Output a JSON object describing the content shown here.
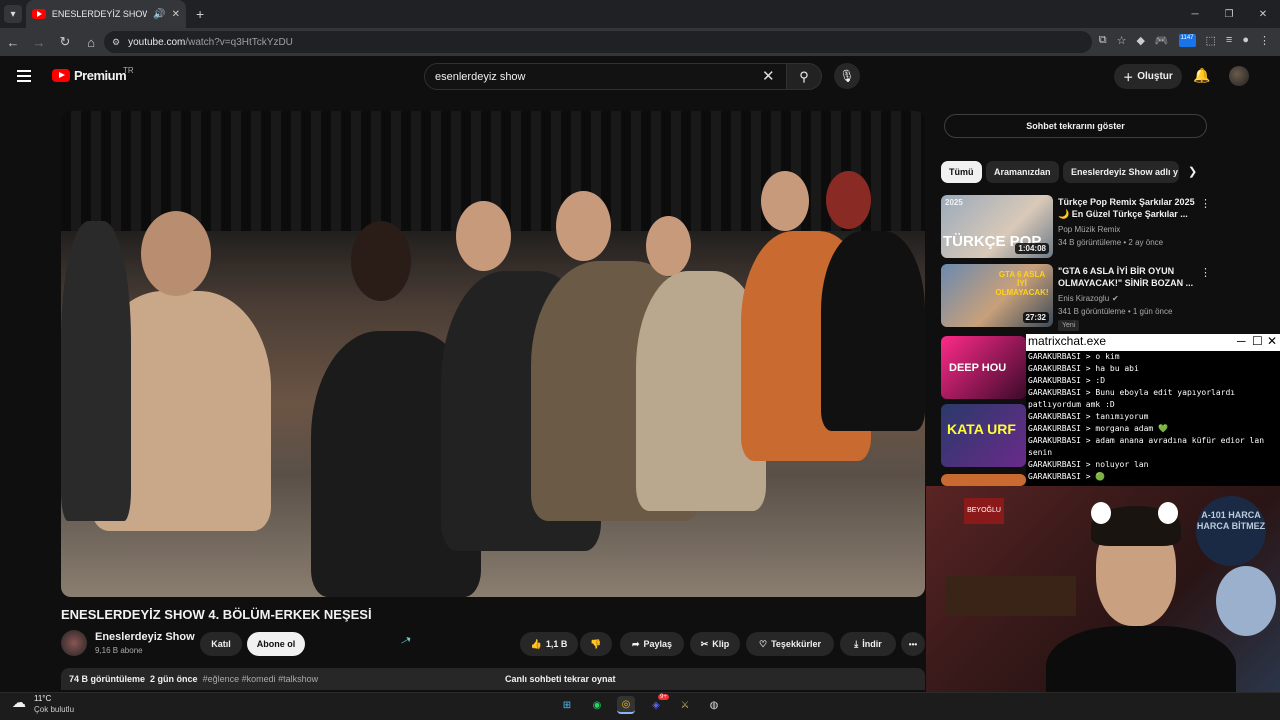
{
  "browser": {
    "tab_title": "ENESLERDEYİZ SHOW 4. BÖ",
    "url_host": "youtube.com",
    "url_path": "/watch?v=q3HtTckYzDU",
    "extension_badge": "1147"
  },
  "header": {
    "logo_text": "Premium",
    "region": "TR",
    "search_value": "esenlerdeyiz show",
    "create_label": "Oluştur"
  },
  "video": {
    "title": "ENESLERDEYİZ SHOW 4. BÖLÜM-ERKEK NEŞESİ",
    "channel_name": "Eneslerdeyiz Show",
    "subscribers": "9,16 B abone",
    "join_label": "Katıl",
    "subscribe_label": "Abone ol",
    "likes": "1,1 B",
    "share_label": "Paylaş",
    "clip_label": "Klip",
    "thanks_label": "Teşekkürler",
    "download_label": "İndir",
    "more_label": "•••",
    "views": "74 B görüntüleme",
    "age": "2 gün önce",
    "hashtags": "#eğlence #komedi #talkshow",
    "chat_replay_label": "Canlı sohbeti tekrar oynat"
  },
  "sidebar": {
    "show_chat_label": "Sohbet tekrarını göster",
    "chips": [
      "Tümü",
      "Aramanızdan",
      "Eneslerdeyiz Show adlı y"
    ],
    "recs": [
      {
        "title": "Türkçe Pop Remix Şarkılar 2025 🌙 En Güzel Türkçe Şarkılar ...",
        "channel": "Pop Müzik Remix",
        "meta": "34 B görüntüleme • 2 ay önce",
        "duration": "1:04:08",
        "thumb_text": "TÜRKÇE POP",
        "thumb_year": "2025"
      },
      {
        "title": "\"GTA 6 ASLA İYİ BİR OYUN OLMAYACAK!\" SİNİR BOZAN ...",
        "channel": "Enis Kirazoglu",
        "meta": "341 B görüntüleme • 1 gün önce",
        "duration": "27:32",
        "tag": "Yeni",
        "thumb_text": "GTA 6 ASLA İYİ OLMAYACAK!"
      },
      {
        "thumb_text": "DEEP HOU"
      },
      {
        "thumb_text": "KATA URF"
      }
    ]
  },
  "chatapp": {
    "title": "matrixchat.exe",
    "lines": [
      "GARAKURBASI > o kim",
      "GARAKURBASI > ha bu abi",
      "GARAKURBASI > :D",
      "GARAKURBASI > Bunu eboyla edit yapıyorlardı patlıyordum amk :D",
      "GARAKURBASI > tanımıyorum",
      "GARAKURBASI > morgana adam 💚",
      "GARAKURBASI > adam anana avradına küfür edior lan senin",
      "GARAKURBASI > noluyor lan",
      "GARAKURBASI > 🟢"
    ]
  },
  "webcam": {
    "sign_text": "A-101 HARCA HARCA BİTMEZ",
    "sign2": "BEYOĞLU"
  },
  "taskbar": {
    "temperature": "11°C",
    "weather": "Çok bulutlu",
    "discord_badge": "9+"
  },
  "colors": {
    "accent": "#ff0000",
    "background": "#0f0f0f",
    "chip_bg": "#272727"
  }
}
